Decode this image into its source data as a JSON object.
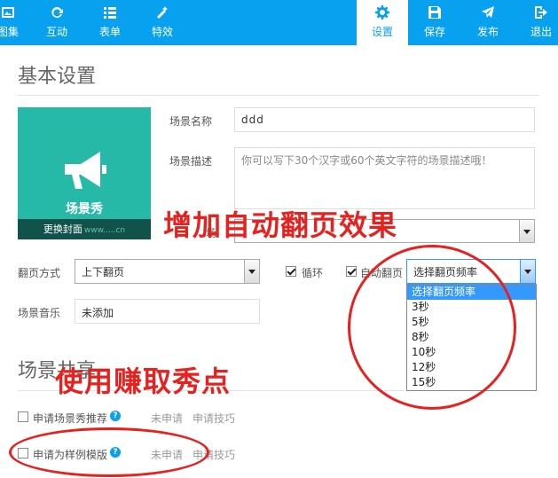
{
  "toolbar": {
    "left_items": [
      {
        "label": "图集",
        "icon": "image-icon"
      },
      {
        "label": "互动",
        "icon": "refresh-icon"
      },
      {
        "label": "表单",
        "icon": "list-icon"
      },
      {
        "label": "特效",
        "icon": "magic-wand-icon"
      }
    ],
    "right_items": [
      {
        "label": "设置",
        "icon": "gear-icon",
        "active": true
      },
      {
        "label": "保存",
        "icon": "save-icon"
      },
      {
        "label": "发布",
        "icon": "send-icon"
      },
      {
        "label": "退出",
        "icon": "exit-icon"
      }
    ],
    "color": "#08a1ef"
  },
  "basic": {
    "title": "基本设置",
    "cover": {
      "brand": "场景秀",
      "change_label": "更换封面",
      "watermark": "www.....cn"
    },
    "scene_name_label": "场景名称",
    "scene_name_value": "ddd",
    "scene_desc_label": "场景描述",
    "scene_desc_placeholder": "你可以写下30个汉字或60个英文字符的场景描述哦！",
    "type_label_partial": "场",
    "page_mode_label": "翻页方式",
    "page_mode_value": "上下翻页",
    "loop_label": "循环",
    "auto_flip_label": "自动翻页",
    "flip_rate_value": "选择翻页频率",
    "flip_rate_options": [
      "选择翻页频率",
      "3秒",
      "5秒",
      "8秒",
      "10秒",
      "12秒",
      "15秒"
    ],
    "music_label": "场景音乐",
    "music_value": "未添加"
  },
  "share": {
    "title": "场景共享",
    "apply_recommend_label": "申请场景秀推荐",
    "apply_template_label": "申请为样例模版",
    "status": "未申请",
    "tips": "申请技巧"
  },
  "annotations": {
    "auto_flip": "增加自动翻页效果",
    "earn_points": "使用赚取秀点",
    "color": "#e5221f"
  }
}
